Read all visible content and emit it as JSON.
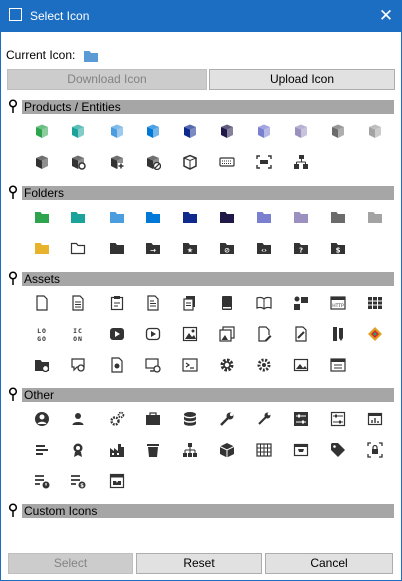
{
  "window": {
    "title": "Select Icon",
    "close_glyph": "✕"
  },
  "current": {
    "label": "Current Icon:",
    "icon": "folder-icon",
    "icon_color": "#5b9bd5"
  },
  "buttons": {
    "download": "Download Icon",
    "upload": "Upload Icon",
    "select": "Select",
    "reset": "Reset",
    "cancel": "Cancel"
  },
  "sections": [
    {
      "name": "products",
      "title": "Products / Entities",
      "icons": [
        [
          "cube-icon",
          "#2ea44f"
        ],
        [
          "cube-icon",
          "#1aa39a"
        ],
        [
          "cube-icon",
          "#4a9ee0"
        ],
        [
          "cube-icon",
          "#0078d7"
        ],
        [
          "cube-icon",
          "#0e2a8c"
        ],
        [
          "cube-icon",
          "#201848"
        ],
        [
          "cube-icon",
          "#7b7fd0"
        ],
        [
          "cube-icon",
          "#9b90c0"
        ],
        [
          "cube-icon",
          "#6b6b6b"
        ],
        [
          "cube-icon",
          "#a3a3a3"
        ],
        [
          "cube-icon",
          "#333333"
        ],
        [
          "cube-gear-icon",
          "#333333"
        ],
        [
          "cube-plus-icon",
          "#333333"
        ],
        [
          "cube-block-icon",
          "#333333"
        ],
        [
          "cube-outline-icon",
          "#333333"
        ],
        [
          "keyboard-icon",
          "#333333"
        ],
        [
          "scan-icon",
          "#333333"
        ],
        [
          "hierarchy-icon",
          "#333333"
        ]
      ]
    },
    {
      "name": "folders",
      "title": "Folders",
      "icons": [
        [
          "folder-icon",
          "#2ea44f"
        ],
        [
          "folder-icon",
          "#1aa39a"
        ],
        [
          "folder-icon",
          "#4a9ee0"
        ],
        [
          "folder-icon",
          "#0078d7"
        ],
        [
          "folder-icon",
          "#0e2a8c"
        ],
        [
          "folder-icon",
          "#201848"
        ],
        [
          "folder-icon",
          "#7b7fd0"
        ],
        [
          "folder-icon",
          "#9b90c0"
        ],
        [
          "folder-icon",
          "#6b6b6b"
        ],
        [
          "folder-icon",
          "#a3a3a3"
        ],
        [
          "folder-icon",
          "#e8b22c"
        ],
        [
          "folder-outline-icon",
          "#333333"
        ],
        [
          "folder-icon",
          "#333333"
        ],
        [
          "folder-arrow-icon",
          "#333333"
        ],
        [
          "folder-star-icon",
          "#333333"
        ],
        [
          "folder-block-icon",
          "#333333"
        ],
        [
          "folder-code-icon",
          "#333333"
        ],
        [
          "folder-question-icon",
          "#333333"
        ],
        [
          "folder-dollar-icon",
          "#333333"
        ]
      ]
    },
    {
      "name": "assets",
      "title": "Assets",
      "icons": [
        [
          "document-icon",
          "#333333"
        ],
        [
          "document-lines-icon",
          "#333333"
        ],
        [
          "clipboard-icon",
          "#333333"
        ],
        [
          "document-text-icon",
          "#333333"
        ],
        [
          "document-copy-icon",
          "#333333"
        ],
        [
          "book-closed-icon",
          "#333333"
        ],
        [
          "book-open-icon",
          "#333333"
        ],
        [
          "presenter-icon",
          "#333333"
        ],
        [
          "http-window-icon",
          "#333333"
        ],
        [
          "table-icon",
          "#333333"
        ],
        [
          "logo-text-icon",
          "#333333"
        ],
        [
          "icon-text-icon",
          "#333333"
        ],
        [
          "play-button-icon",
          "#333333"
        ],
        [
          "play-outline-icon",
          "#333333"
        ],
        [
          "image-file-icon",
          "#333333"
        ],
        [
          "images-icon",
          "#333333"
        ],
        [
          "edit-document-icon",
          "#333333"
        ],
        [
          "draw-icon",
          "#333333"
        ],
        [
          "pencil-ruler-icon",
          "#333333"
        ],
        [
          "palette-icon",
          "#e0a020"
        ],
        [
          "folder-gear-icon",
          "#333333"
        ],
        [
          "chat-gear-icon",
          "#333333"
        ],
        [
          "file-gear-icon",
          "#333333"
        ],
        [
          "monitor-gear-icon",
          "#333333"
        ],
        [
          "terminal-icon",
          "#333333"
        ],
        [
          "gear-icon",
          "#333333"
        ],
        [
          "gears-icon",
          "#333333"
        ],
        [
          "folder-image-icon",
          "#333333"
        ],
        [
          "window-list-icon",
          "#333333"
        ]
      ]
    },
    {
      "name": "other",
      "title": "Other",
      "icons": [
        [
          "user-circle-icon",
          "#333333"
        ],
        [
          "user-icon",
          "#333333"
        ],
        [
          "cogs-icon",
          "#333333"
        ],
        [
          "briefcase-icon",
          "#333333"
        ],
        [
          "database-icon",
          "#333333"
        ],
        [
          "wrench-icon",
          "#333333"
        ],
        [
          "wrench-alt-icon",
          "#333333"
        ],
        [
          "sliders-icon",
          "#333333"
        ],
        [
          "sliders-outline-icon",
          "#333333"
        ],
        [
          "dashboard-icon",
          "#333333"
        ],
        [
          "bar-list-icon",
          "#333333"
        ],
        [
          "award-icon",
          "#333333"
        ],
        [
          "factory-icon",
          "#333333"
        ],
        [
          "trash-icon",
          "#333333"
        ],
        [
          "network-icon",
          "#333333"
        ],
        [
          "box-icon",
          "#333333"
        ],
        [
          "grid-icon",
          "#333333"
        ],
        [
          "cart-window-icon",
          "#333333"
        ],
        [
          "tag-icon",
          "#333333"
        ],
        [
          "lock-frame-icon",
          "#333333"
        ],
        [
          "list-alert-icon",
          "#333333"
        ],
        [
          "list-dollar-icon",
          "#333333"
        ],
        [
          "inbox-window-icon",
          "#333333"
        ]
      ]
    },
    {
      "name": "custom",
      "title": "Custom Icons",
      "icons": []
    }
  ]
}
